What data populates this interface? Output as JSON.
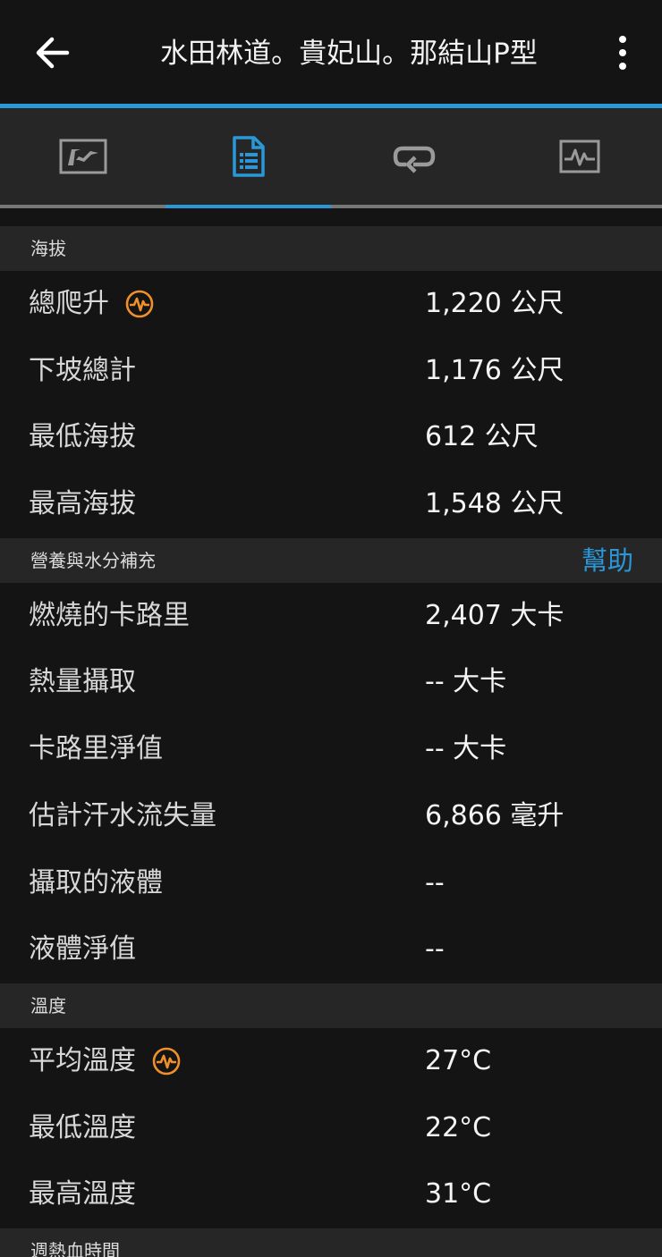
{
  "header": {
    "title": "水田林道。貴妃山。那結山P型",
    "back_icon": "arrow-left-icon",
    "menu_icon": "more-vertical-icon"
  },
  "tabs": [
    {
      "name": "map",
      "icon": "map-icon",
      "active": false
    },
    {
      "name": "stats",
      "icon": "document-list-icon",
      "active": true
    },
    {
      "name": "laps",
      "icon": "loop-icon",
      "active": false
    },
    {
      "name": "charts",
      "icon": "chart-icon",
      "active": false
    }
  ],
  "colors": {
    "accent": "#2a98d8",
    "badge": "#f0902a",
    "background": "#141414",
    "section": "#262626"
  },
  "sections": {
    "elevation": {
      "title": "海拔",
      "rows": [
        {
          "label": "總爬升",
          "value": "1,220 公尺",
          "badge": "pulse-badge-icon"
        },
        {
          "label": "下坡總計",
          "value": "1,176 公尺"
        },
        {
          "label": "最低海拔",
          "value": "612 公尺"
        },
        {
          "label": "最高海拔",
          "value": "1,548 公尺"
        }
      ]
    },
    "nutrition": {
      "title": "營養與水分補充",
      "help": "幫助",
      "rows": [
        {
          "label": "燃燒的卡路里",
          "value": "2,407 大卡"
        },
        {
          "label": "熱量攝取",
          "value": "-- 大卡"
        },
        {
          "label": "卡路里淨值",
          "value": "-- 大卡"
        },
        {
          "label": "估計汗水流失量",
          "value": "6,866 毫升"
        },
        {
          "label": "攝取的液體",
          "value": "--"
        },
        {
          "label": "液體淨值",
          "value": "--"
        }
      ]
    },
    "temperature": {
      "title": "溫度",
      "rows": [
        {
          "label": "平均溫度",
          "value": "27°C",
          "badge": "pulse-badge-icon"
        },
        {
          "label": "最低溫度",
          "value": "22°C"
        },
        {
          "label": "最高溫度",
          "value": "31°C"
        }
      ]
    },
    "heat": {
      "title": "週熱血時間"
    }
  }
}
